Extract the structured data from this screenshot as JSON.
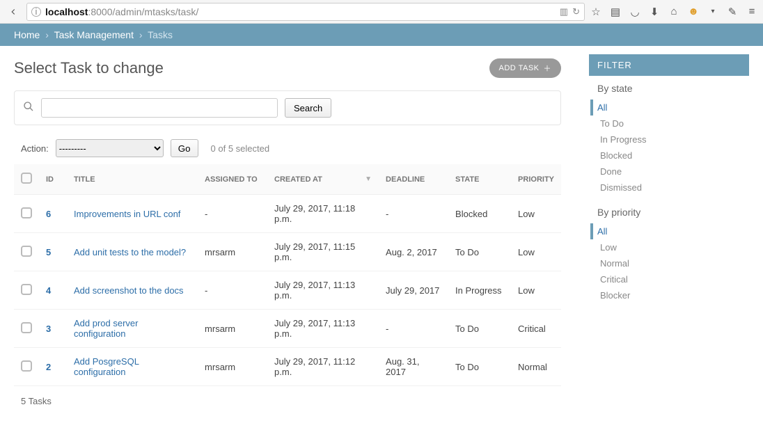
{
  "url": {
    "prefix": "localhost",
    "rest": ":8000/admin/mtasks/task/"
  },
  "breadcrumb": {
    "home": "Home",
    "parent": "Task Management",
    "current": "Tasks"
  },
  "page_title": "Select Task to change",
  "add_button": "ADD TASK",
  "search": {
    "button": "Search",
    "value": "",
    "placeholder": ""
  },
  "actions": {
    "label": "Action:",
    "placeholder": "---------",
    "go": "Go",
    "selected": "0 of 5 selected"
  },
  "columns": {
    "id": "ID",
    "title": "TITLE",
    "assigned": "ASSIGNED TO",
    "created": "CREATED AT",
    "deadline": "DEADLINE",
    "state": "STATE",
    "priority": "PRIORITY"
  },
  "rows": [
    {
      "id": "6",
      "title": "Improvements in URL conf",
      "assigned": "-",
      "created": "July 29, 2017, 11:18 p.m.",
      "deadline": "-",
      "state": "Blocked",
      "priority": "Low"
    },
    {
      "id": "5",
      "title": "Add unit tests to the model?",
      "assigned": "mrsarm",
      "created": "July 29, 2017, 11:15 p.m.",
      "deadline": "Aug. 2, 2017",
      "state": "To Do",
      "priority": "Low"
    },
    {
      "id": "4",
      "title": "Add screenshot to the docs",
      "assigned": "-",
      "created": "July 29, 2017, 11:13 p.m.",
      "deadline": "July 29, 2017",
      "state": "In Progress",
      "priority": "Low"
    },
    {
      "id": "3",
      "title": "Add prod server configuration",
      "assigned": "mrsarm",
      "created": "July 29, 2017, 11:13 p.m.",
      "deadline": "-",
      "state": "To Do",
      "priority": "Critical"
    },
    {
      "id": "2",
      "title": "Add PosgreSQL configuration",
      "assigned": "mrsarm",
      "created": "July 29, 2017, 11:12 p.m.",
      "deadline": "Aug. 31, 2017",
      "state": "To Do",
      "priority": "Normal"
    }
  ],
  "footer_count": "5 Tasks",
  "filter": {
    "heading": "FILTER",
    "by_state": {
      "label": "By state",
      "options": [
        "All",
        "To Do",
        "In Progress",
        "Blocked",
        "Done",
        "Dismissed"
      ],
      "active": "All"
    },
    "by_priority": {
      "label": "By priority",
      "options": [
        "All",
        "Low",
        "Normal",
        "Critical",
        "Blocker"
      ],
      "active": "All"
    }
  }
}
